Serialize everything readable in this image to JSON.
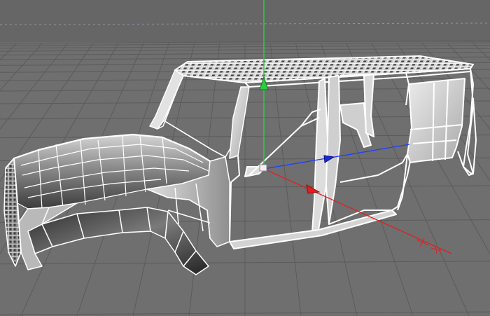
{
  "viewport": {
    "view_name": "",
    "background_color": "#6f6f6f",
    "horizon_color": "#676767",
    "grid_line_color": "#5c5c5c",
    "horizon_line_color": "#8a96a6"
  },
  "model": {
    "type": "polygon-mesh",
    "subject": "suv-body-shell",
    "wire_color": "#ffffff",
    "shade_dark": "#3a3a3a",
    "shade_light": "#d8d8d8"
  },
  "gizmo": {
    "type": "move-gizmo",
    "y_axis_color": "#2ecc40",
    "x_axis_color": "#e02020",
    "z_axis_color": "#1f3fff"
  },
  "icons": [
    "y-axis-arrow-icon",
    "x-axis-arrow-icon",
    "z-axis-arrow-icon",
    "gizmo-origin-icon"
  ]
}
